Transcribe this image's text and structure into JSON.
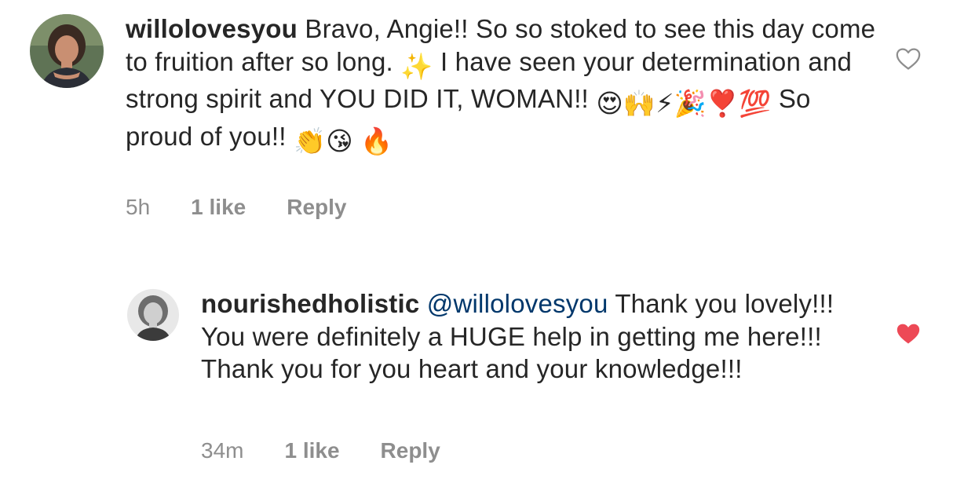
{
  "comments": [
    {
      "username": "willolovesyou",
      "text_parts": [
        "Bravo, Angie!! So so stoked to see this day come to fruition after so long.",
        "I have seen your determination and strong spirit and YOU DID IT, WOMAN!!",
        "So proud of you!!"
      ],
      "emojis_1": "✨",
      "emojis_2": "😍🙌⚡🎉❣️💯",
      "emojis_3": "👏😘",
      "emojis_4": "🔥",
      "time": "5h",
      "likes": "1 like",
      "reply": "Reply",
      "liked": false
    },
    {
      "username": "nourishedholistic",
      "mention": "@willolovesyou",
      "text": "Thank you lovely!!! You were definitely a HUGE help in getting me here!!! Thank you for you heart and your knowledge!!!",
      "time": "34m",
      "likes": "1 like",
      "reply": "Reply",
      "liked": true
    }
  ],
  "colors": {
    "heart_liked": "#ed4956",
    "heart_outline": "#8e8e8e",
    "mention": "#00376b"
  }
}
